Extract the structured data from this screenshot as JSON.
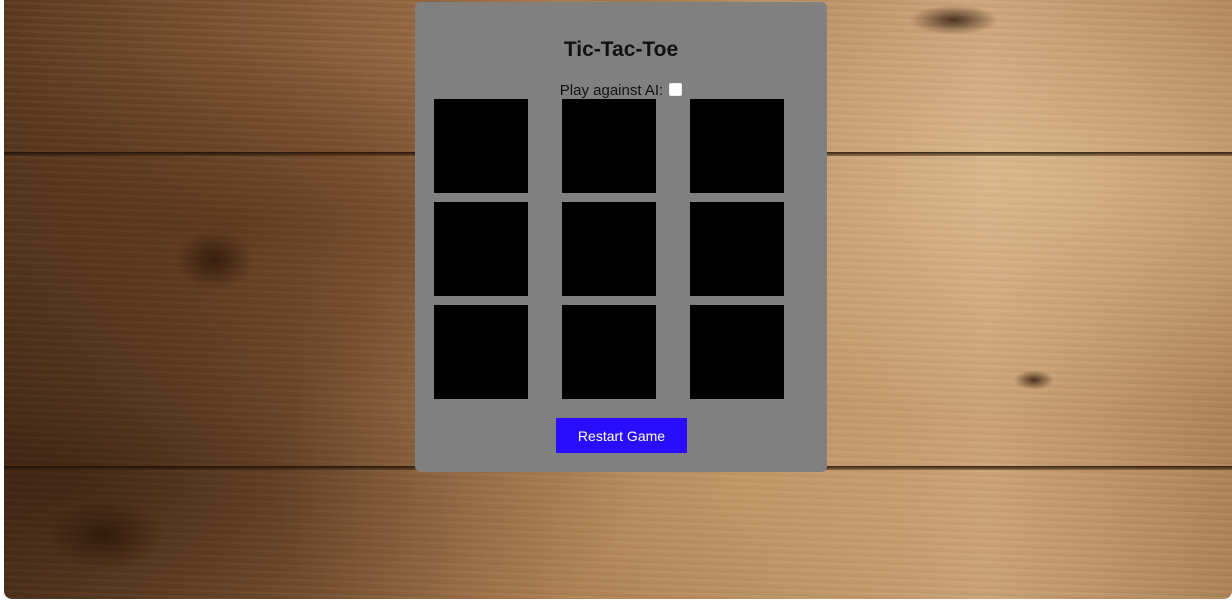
{
  "game": {
    "title": "Tic-Tac-Toe",
    "ai_toggle_label": "Play against AI:",
    "ai_enabled": false,
    "restart_label": "Restart Game",
    "board": [
      "",
      "",
      "",
      "",
      "",
      "",
      "",
      "",
      ""
    ]
  },
  "colors": {
    "panel": "#808080",
    "cell": "#000000",
    "restart_button": "#2a0dff"
  }
}
